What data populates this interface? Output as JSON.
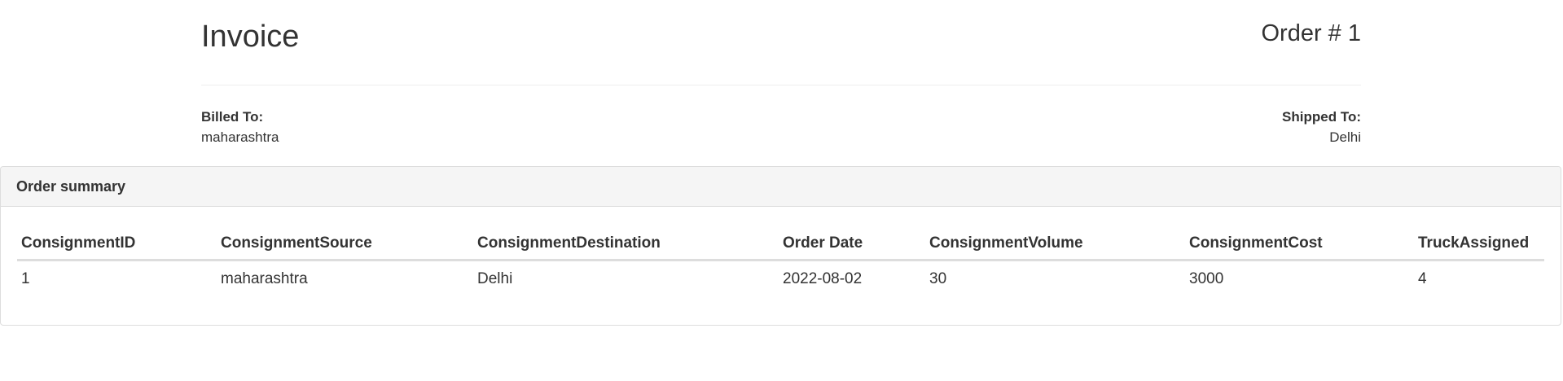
{
  "invoice": {
    "title": "Invoice",
    "order_number": "Order # 1"
  },
  "billed_to": {
    "label": "Billed To:",
    "value": "maharashtra"
  },
  "shipped_to": {
    "label": "Shipped To:",
    "value": "Delhi"
  },
  "order_summary": {
    "heading": "Order summary",
    "columns": [
      "ConsignmentID",
      "ConsignmentSource",
      "ConsignmentDestination",
      "Order Date",
      "ConsignmentVolume",
      "ConsignmentCost",
      "TruckAssigned"
    ],
    "rows": [
      [
        "1",
        "maharashtra",
        "Delhi",
        "2022-08-02",
        "30",
        "3000",
        "4"
      ]
    ]
  }
}
